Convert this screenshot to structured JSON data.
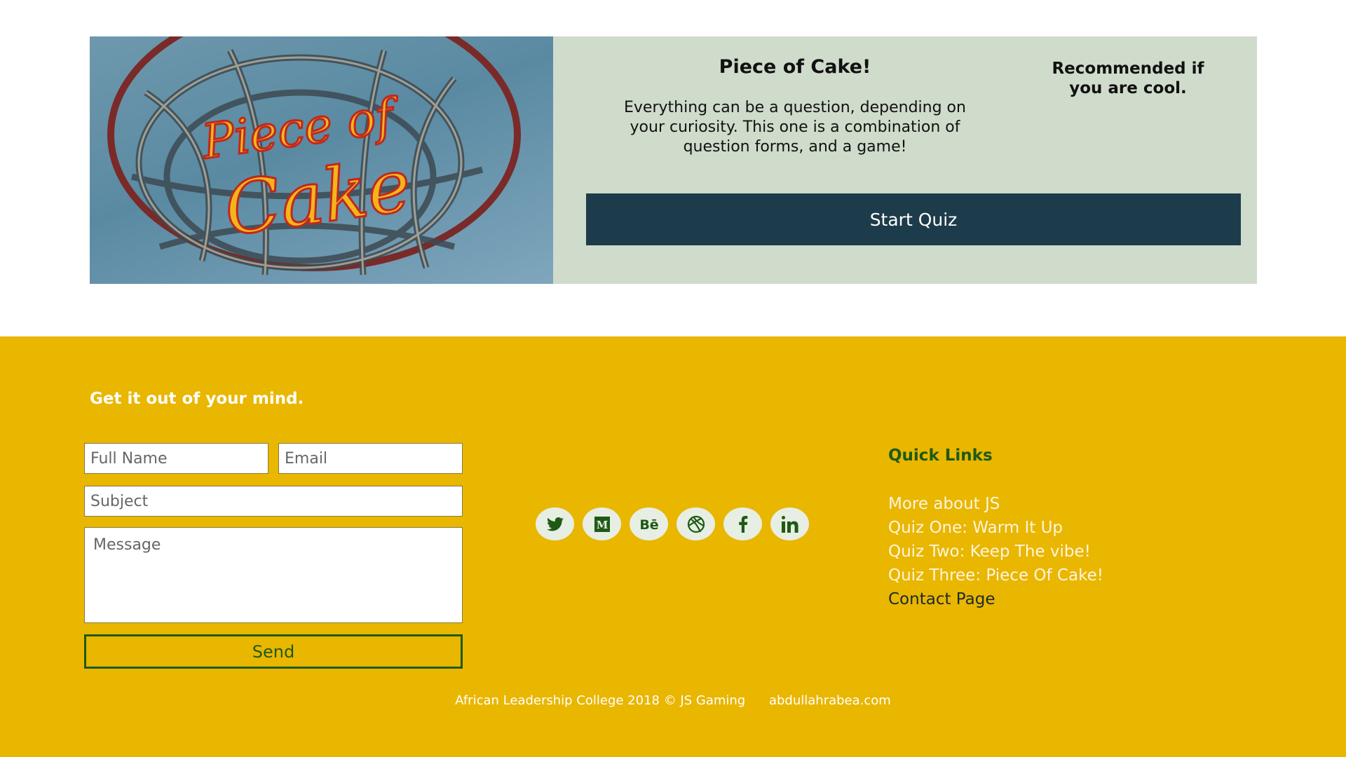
{
  "quiz": {
    "image_text_line1": "Piece of",
    "image_text_line2": "Cake",
    "title": "Piece of Cake!",
    "description": "Everything can be a question, depending on your curiosity. This one is a combination of question forms, and a game!",
    "recommendation": "Recommended if you are cool.",
    "start_label": "Start Quiz"
  },
  "footer": {
    "heading": "Get it out of your mind.",
    "form": {
      "fullname_placeholder": "Full Name",
      "email_placeholder": "Email",
      "subject_placeholder": "Subject",
      "message_placeholder": "Message",
      "send_label": "Send"
    },
    "socials": [
      "twitter-icon",
      "medium-icon",
      "behance-icon",
      "dribbble-icon",
      "facebook-icon",
      "linkedin-icon"
    ],
    "quick_links_title": "Quick Links",
    "quick_links": [
      "More about JS",
      "Quiz One: Warm It Up",
      "Quiz Two: Keep The vibe!",
      "Quiz Three: Piece Of Cake!",
      "Contact Page"
    ],
    "copyright": "African Leadership College 2018 © JS Gaming",
    "site": "abdullahrabea.com"
  },
  "colors": {
    "footer_bg": "#e9b600",
    "card_bg": "#cfdbcb",
    "button_dark": "#1d3c4b",
    "accent_green": "#1e5a14"
  }
}
